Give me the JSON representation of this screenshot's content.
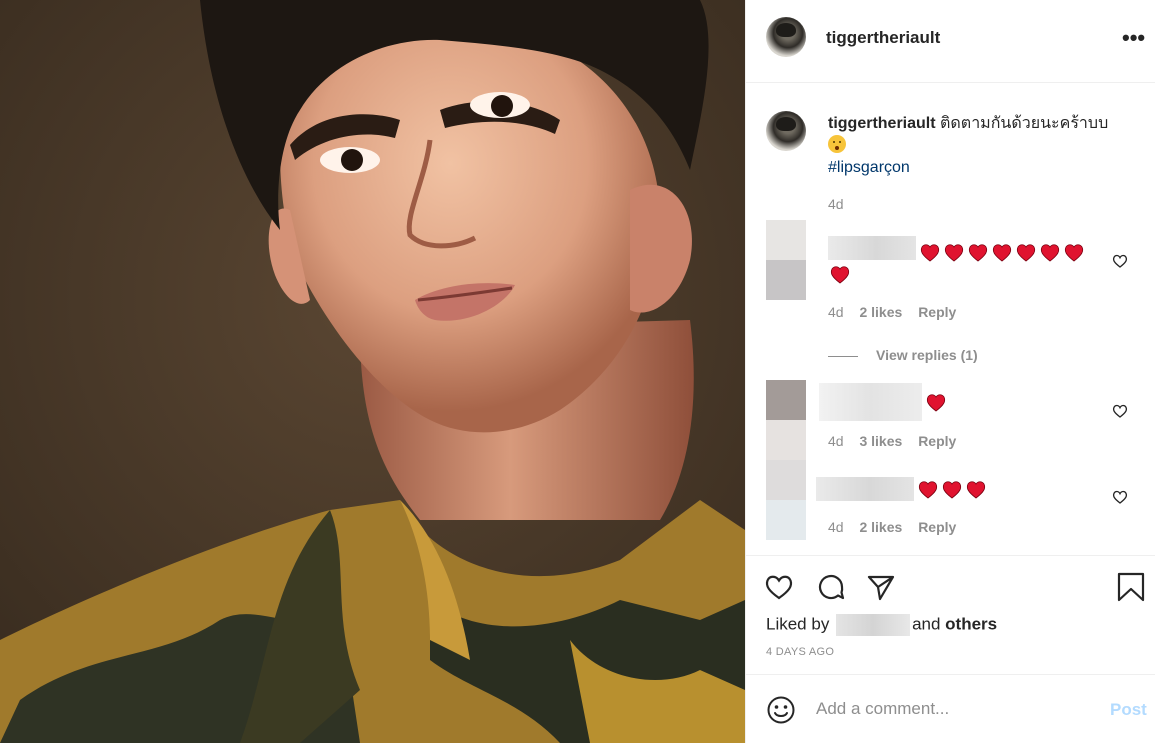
{
  "post": {
    "username": "tiggertheriault",
    "more_label": "•••",
    "caption_text": "ติดตามกันด้วยนะคร้าบบ",
    "hashtag": "#lipsgarçon",
    "caption_time": "4d"
  },
  "comments": [
    {
      "time": "4d",
      "likes": "2 likes",
      "reply": "Reply",
      "hearts": 8
    },
    {
      "time": "4d",
      "likes": "3 likes",
      "reply": "Reply",
      "hearts": 1
    },
    {
      "time": "4d",
      "likes": "2 likes",
      "reply": "Reply",
      "hearts": 3
    }
  ],
  "view_replies": "View replies (1)",
  "liked_by": {
    "prefix": "Liked by",
    "middle": "and",
    "others": "others"
  },
  "time_ago": "4 DAYS AGO",
  "add_comment": {
    "placeholder": "Add a comment...",
    "post_label": "Post"
  },
  "colors": {
    "link": "#00376b",
    "muted": "#8e8e8e",
    "post_disabled": "#b3dbff",
    "heart": "#e0132f"
  },
  "icons": [
    "more-icon",
    "heart-icon",
    "comment-icon",
    "share-icon",
    "bookmark-icon",
    "smiley-icon"
  ]
}
